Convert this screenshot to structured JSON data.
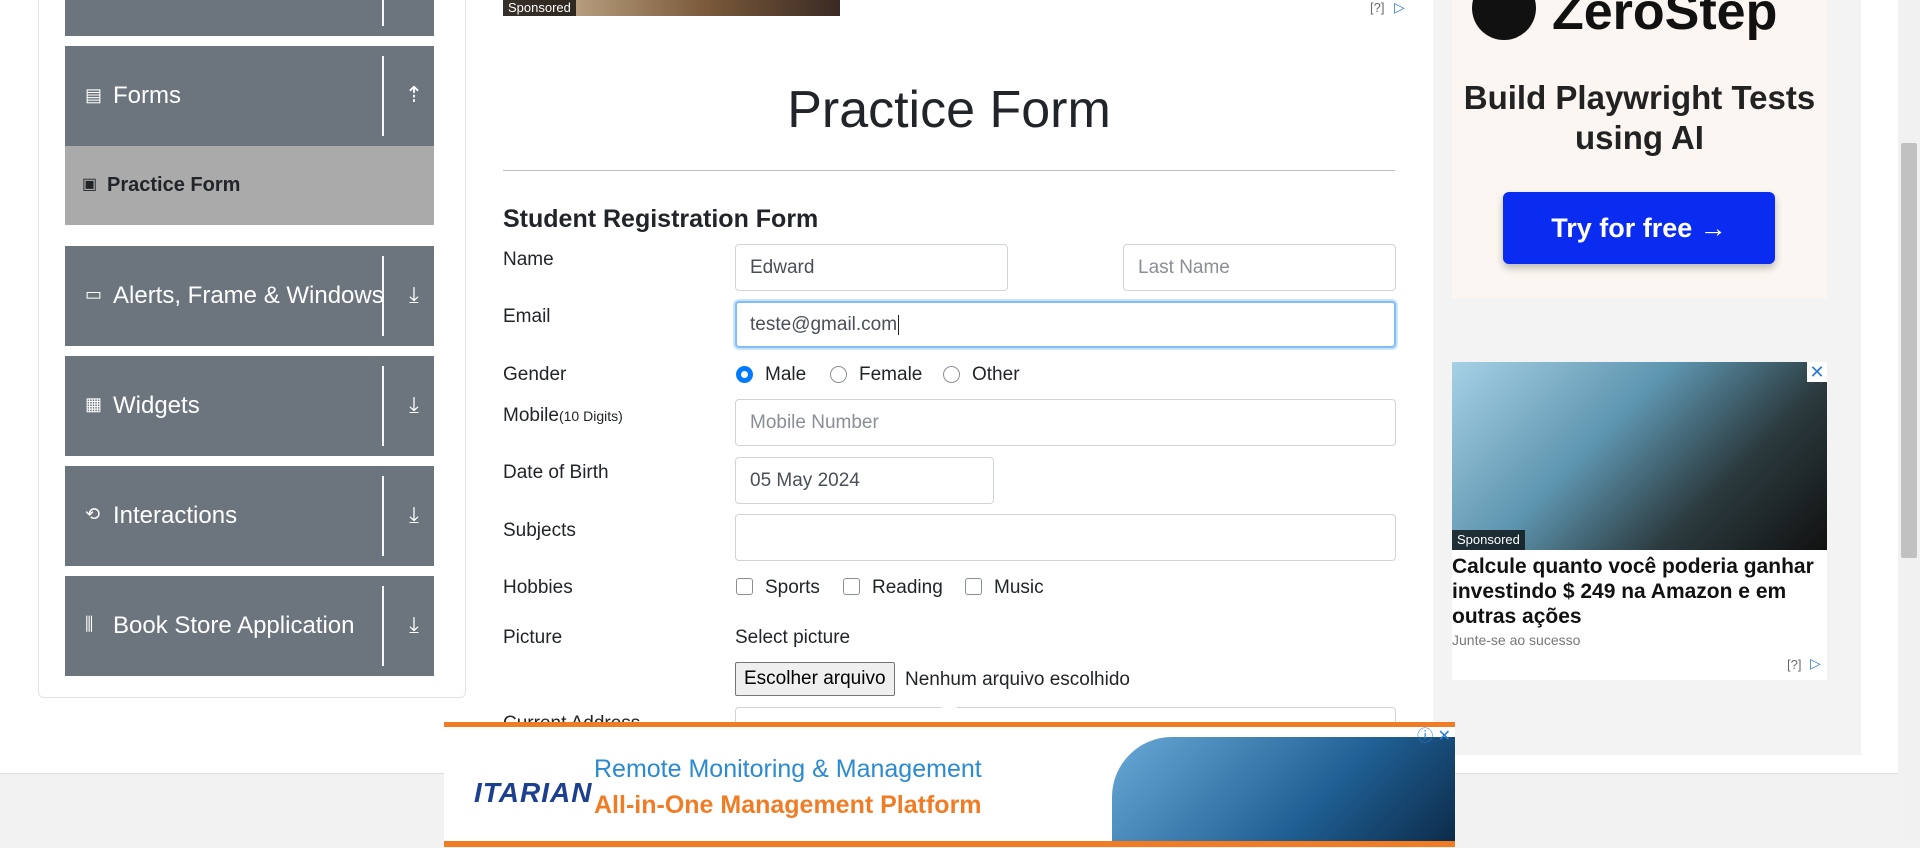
{
  "sidebar": {
    "groups": [
      {
        "label": "Forms",
        "icon": "form-icon",
        "arrow": "⇡"
      },
      {
        "label": "Alerts, Frame & Windows",
        "icon": "window-icon",
        "arrow": "⤓"
      },
      {
        "label": "Widgets",
        "icon": "widgets-icon",
        "arrow": "⤓"
      },
      {
        "label": "Interactions",
        "icon": "interactions-icon",
        "arrow": "⤓"
      },
      {
        "label": "Book Store Application",
        "icon": "books-icon",
        "arrow": "⤓"
      }
    ],
    "active_item": "Practice Form"
  },
  "top_ad": {
    "sponsored": "Sponsored",
    "info": "[?]"
  },
  "main": {
    "page_title": "Practice Form",
    "form_title": "Student Registration Form",
    "name": {
      "label": "Name",
      "first_value": "Edward",
      "last_placeholder": "Last Name"
    },
    "email": {
      "label": "Email",
      "value": "teste@gmail.com"
    },
    "gender": {
      "label": "Gender",
      "options": [
        "Male",
        "Female",
        "Other"
      ],
      "selected": "Male"
    },
    "mobile": {
      "label": "Mobile",
      "label_hint": "(10 Digits)",
      "placeholder": "Mobile Number"
    },
    "dob": {
      "label": "Date of Birth",
      "value": "05 May 2024"
    },
    "subjects": {
      "label": "Subjects",
      "value": ""
    },
    "hobbies": {
      "label": "Hobbies",
      "options": [
        "Sports",
        "Reading",
        "Music"
      ]
    },
    "picture": {
      "label": "Picture",
      "prompt": "Select picture",
      "button": "Escolher arquivo",
      "status": "Nenhum arquivo escolhido"
    },
    "address": {
      "label": "Current Address"
    }
  },
  "right_ads": {
    "zerostep": {
      "brand": "ZeroStep",
      "headline": "Build Playwright Tests using AI",
      "cta": "Try for free →"
    },
    "amazon": {
      "sponsored": "Sponsored",
      "title": "Calcule quanto você poderia ganhar investindo $ 249 na Amazon e em outras ações",
      "subtitle": "Junte-se ao sucesso",
      "info": "[?]"
    }
  },
  "bottom_ad": {
    "logo": "ITARIAN",
    "line1": "Remote Monitoring & Management",
    "line2": "All-in-One Management Platform"
  },
  "colors": {
    "sidebar": "#6c757d",
    "active": "#aaaaaa",
    "primary": "#007bff",
    "ad_cta": "#0a2cf0",
    "ad_orange": "#f07d26"
  }
}
